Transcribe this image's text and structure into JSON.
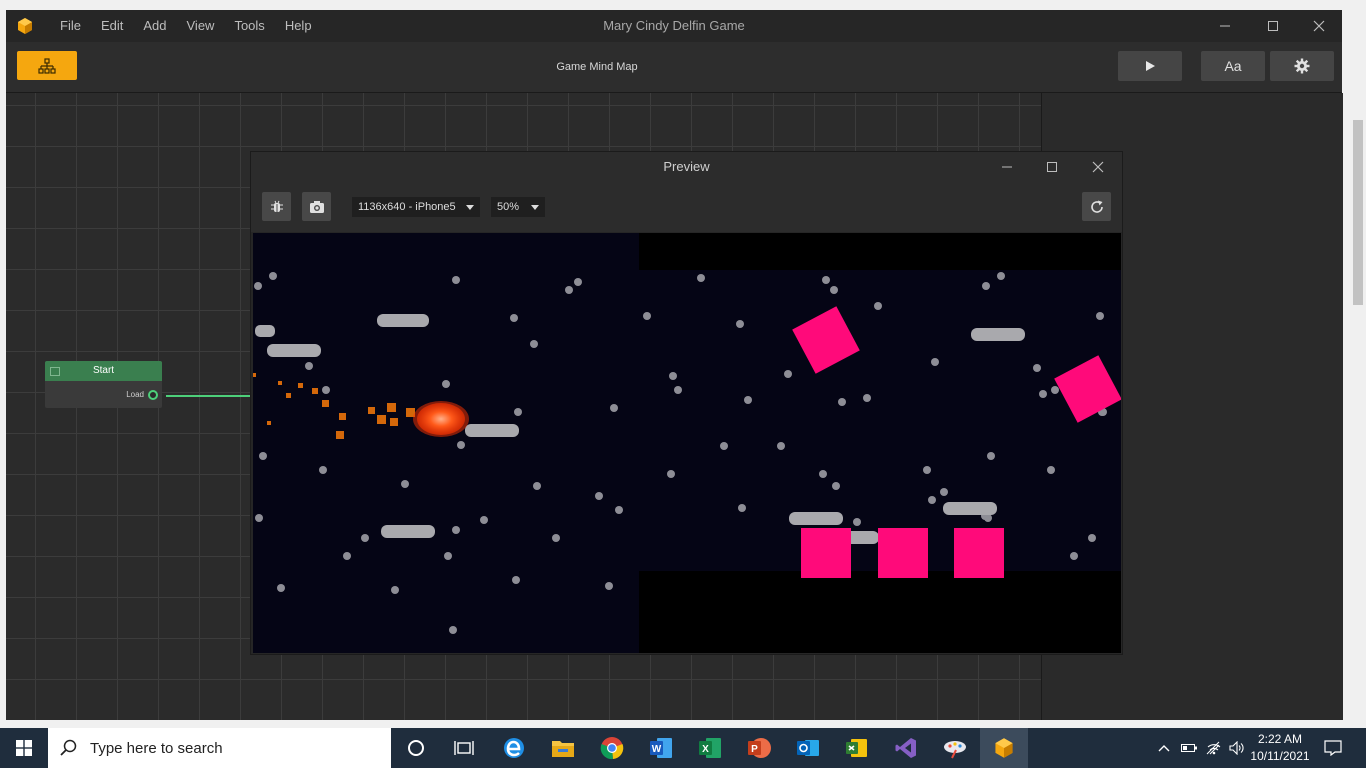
{
  "app": {
    "title": "Mary Cindy Delfin Game",
    "menu": [
      "File",
      "Edit",
      "Add",
      "View",
      "Tools",
      "Help"
    ],
    "toolbar_title": "Game Mind Map",
    "font_button_label": "Aa",
    "accent_color": "#f5a70f"
  },
  "node": {
    "title": "Start",
    "port_label": "Load",
    "header_color": "#3a7f4f",
    "wire_color": "#4dd07a"
  },
  "preview": {
    "title": "Preview",
    "resolution": "1136x640 - iPhone5",
    "zoom": "50%"
  },
  "game": {
    "background_color": "#050515",
    "block_color": "#ff0a7a",
    "player_color": "#ff4a12"
  },
  "taskbar": {
    "search_placeholder": "Type here to search",
    "time": "2:22 AM",
    "date": "10/11/2021",
    "apps": [
      "task-view",
      "edge",
      "file-explorer",
      "chrome",
      "word",
      "excel",
      "powerpoint",
      "outlook",
      "project",
      "visual-studio",
      "paint",
      "game-builder"
    ]
  }
}
